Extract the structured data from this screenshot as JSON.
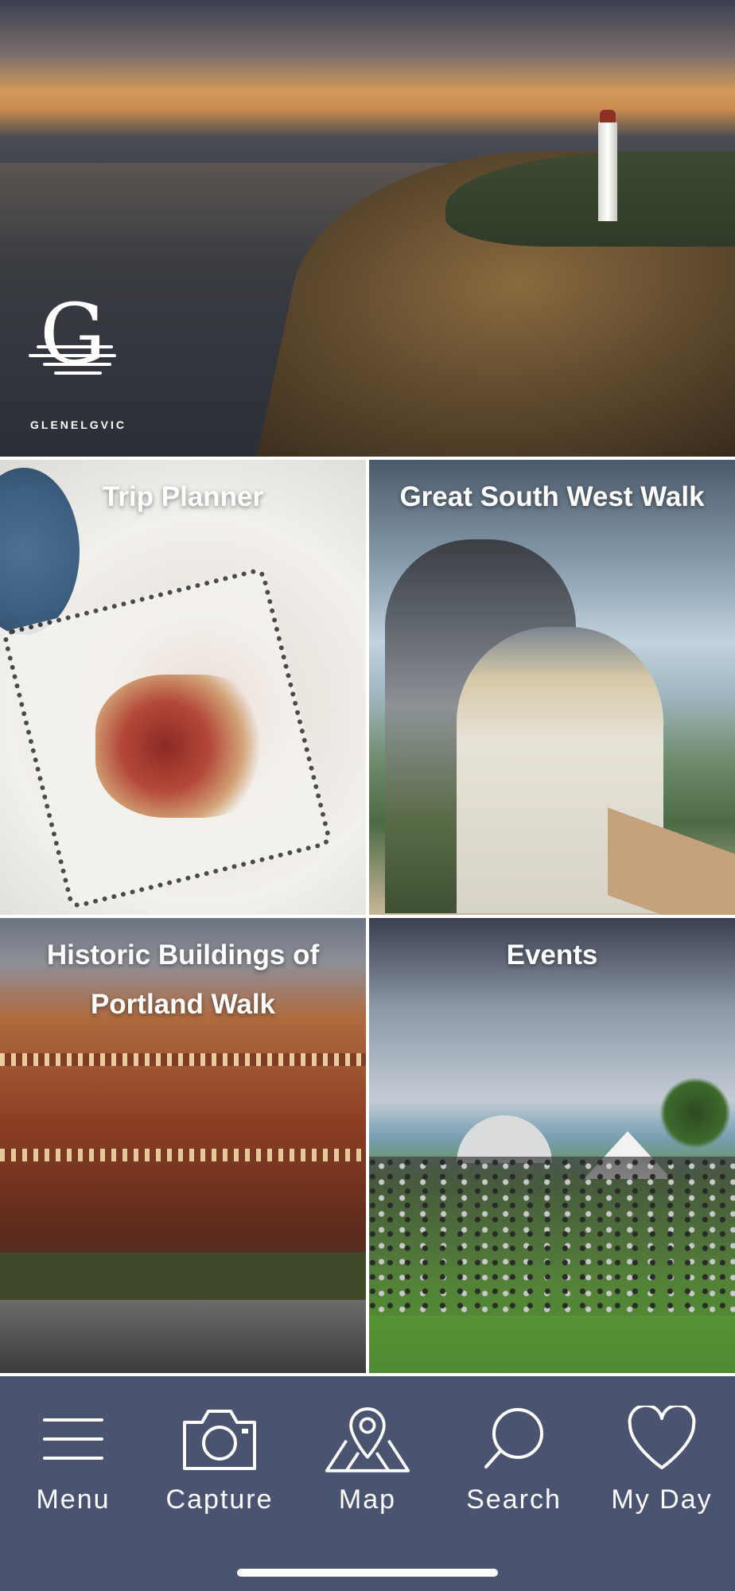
{
  "hero": {
    "logo_text": "GLENELGVIC",
    "logo_letter": "G"
  },
  "tiles": [
    {
      "title": "Trip Planner"
    },
    {
      "title": "Great South West Walk"
    },
    {
      "title": "Historic Buildings of Portland Walk"
    },
    {
      "title": "Events"
    }
  ],
  "nav": {
    "items": [
      {
        "label": "Menu",
        "icon": "hamburger-menu-icon"
      },
      {
        "label": "Capture",
        "icon": "camera-icon"
      },
      {
        "label": "Map",
        "icon": "map-pin-icon"
      },
      {
        "label": "Search",
        "icon": "search-icon"
      },
      {
        "label": "My Day",
        "icon": "heart-icon"
      }
    ]
  },
  "colors": {
    "nav_background": "#4a5470",
    "text": "#ffffff"
  }
}
